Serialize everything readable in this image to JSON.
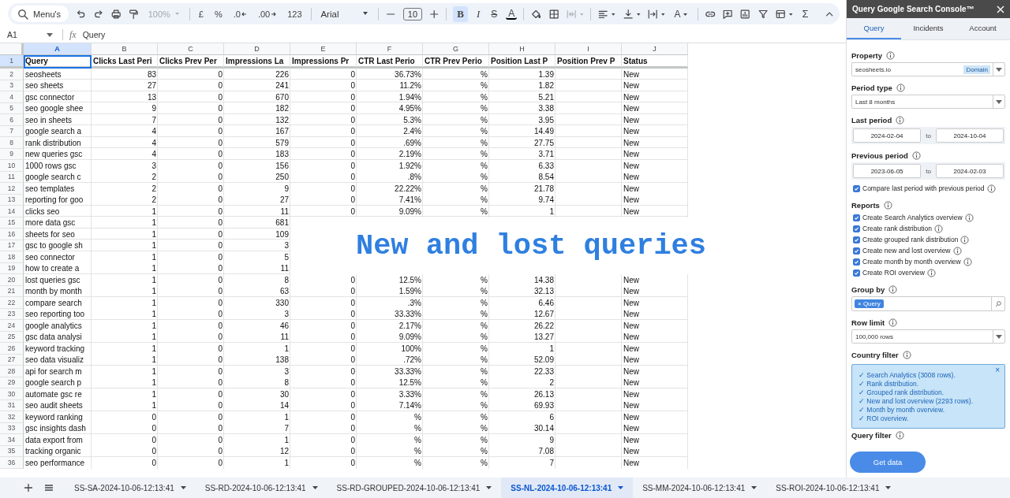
{
  "toolbar": {
    "search": "Menu's",
    "zoom": {
      "label": "100%",
      "disabled": true
    },
    "currency": "£",
    "percent": "%",
    "decrease_decimals": ".0",
    "increase_decimals": ".00",
    "number_format": "123",
    "font": "Arial",
    "font_size": "10",
    "bold": {
      "glyph": "B",
      "selected": true
    },
    "italic": {
      "glyph": "I",
      "selected": false
    },
    "strikethrough": {
      "glyph": "S"
    },
    "text_color": {
      "glyph": "A"
    },
    "merge": {
      "disabled": true
    },
    "text_rotation": {
      "glyph": "A"
    },
    "functions": "Σ"
  },
  "formula_bar": {
    "cell": "A1",
    "fx": "fx",
    "value": "Query"
  },
  "columns": [
    {
      "letter": "A",
      "selected": true
    },
    {
      "letter": "B",
      "selected": false
    },
    {
      "letter": "C",
      "selected": false
    },
    {
      "letter": "D",
      "selected": false
    },
    {
      "letter": "E",
      "selected": false
    },
    {
      "letter": "F",
      "selected": false
    },
    {
      "letter": "G",
      "selected": false
    },
    {
      "letter": "H",
      "selected": false
    },
    {
      "letter": "I",
      "selected": false
    },
    {
      "letter": "J",
      "selected": false
    }
  ],
  "header_row": {
    "number": "1",
    "cells": [
      {
        "text": "Query",
        "selected": true
      },
      {
        "text": "Clicks Last Peri",
        "selected": false
      },
      {
        "text": "Clicks Prev Per",
        "selected": false
      },
      {
        "text": "Impressions La",
        "selected": false
      },
      {
        "text": "Impressions Pr",
        "selected": false
      },
      {
        "text": "CTR Last Perio",
        "selected": false
      },
      {
        "text": "CTR Prev Perio",
        "selected": false
      },
      {
        "text": "Position Last P",
        "selected": false
      },
      {
        "text": "Position Prev P",
        "selected": false
      },
      {
        "text": "Status",
        "selected": false
      }
    ]
  },
  "rows": [
    {
      "number": "2",
      "query": "seosheets",
      "clicks_last": "83",
      "clicks_prev": "0",
      "impr_last": "226",
      "impr_prev": "0",
      "ctr_last": "36.73%",
      "ctr_prev": "%",
      "pos_last": "1.39",
      "status": "New"
    },
    {
      "number": "3",
      "query": "seo sheets",
      "clicks_last": "27",
      "clicks_prev": "0",
      "impr_last": "241",
      "impr_prev": "0",
      "ctr_last": "11.2%",
      "ctr_prev": "%",
      "pos_last": "1.82",
      "status": "New"
    },
    {
      "number": "4",
      "query": "gsc connector",
      "clicks_last": "13",
      "clicks_prev": "0",
      "impr_last": "670",
      "impr_prev": "0",
      "ctr_last": "1.94%",
      "ctr_prev": "%",
      "pos_last": "5.21",
      "status": "New"
    },
    {
      "number": "5",
      "query": "seo google shee",
      "clicks_last": "9",
      "clicks_prev": "0",
      "impr_last": "182",
      "impr_prev": "0",
      "ctr_last": "4.95%",
      "ctr_prev": "%",
      "pos_last": "3.38",
      "status": "New"
    },
    {
      "number": "6",
      "query": "seo in sheets",
      "clicks_last": "7",
      "clicks_prev": "0",
      "impr_last": "132",
      "impr_prev": "0",
      "ctr_last": "5.3%",
      "ctr_prev": "%",
      "pos_last": "3.95",
      "status": "New"
    },
    {
      "number": "7",
      "query": "google search a",
      "clicks_last": "4",
      "clicks_prev": "0",
      "impr_last": "167",
      "impr_prev": "0",
      "ctr_last": "2.4%",
      "ctr_prev": "%",
      "pos_last": "14.49",
      "status": "New"
    },
    {
      "number": "8",
      "query": "rank distribution",
      "clicks_last": "4",
      "clicks_prev": "0",
      "impr_last": "579",
      "impr_prev": "0",
      "ctr_last": ".69%",
      "ctr_prev": "%",
      "pos_last": "27.75",
      "status": "New"
    },
    {
      "number": "9",
      "query": "new queries gsc",
      "clicks_last": "4",
      "clicks_prev": "0",
      "impr_last": "183",
      "impr_prev": "0",
      "ctr_last": "2.19%",
      "ctr_prev": "%",
      "pos_last": "3.71",
      "status": "New"
    },
    {
      "number": "10",
      "query": "1000 rows gsc",
      "clicks_last": "3",
      "clicks_prev": "0",
      "impr_last": "156",
      "impr_prev": "0",
      "ctr_last": "1.92%",
      "ctr_prev": "%",
      "pos_last": "6.33",
      "status": "New"
    },
    {
      "number": "11",
      "query": "google search c",
      "clicks_last": "2",
      "clicks_prev": "0",
      "impr_last": "250",
      "impr_prev": "0",
      "ctr_last": ".8%",
      "ctr_prev": "%",
      "pos_last": "8.54",
      "status": "New"
    },
    {
      "number": "12",
      "query": "seo templates",
      "clicks_last": "2",
      "clicks_prev": "0",
      "impr_last": "9",
      "impr_prev": "0",
      "ctr_last": "22.22%",
      "ctr_prev": "%",
      "pos_last": "21.78",
      "status": "New"
    },
    {
      "number": "13",
      "query": "reporting for goo",
      "clicks_last": "2",
      "clicks_prev": "0",
      "impr_last": "27",
      "impr_prev": "0",
      "ctr_last": "7.41%",
      "ctr_prev": "%",
      "pos_last": "9.74",
      "status": "New"
    },
    {
      "number": "14",
      "query": "clicks seo",
      "clicks_last": "1",
      "clicks_prev": "0",
      "impr_last": "11",
      "impr_prev": "0",
      "ctr_last": "9.09%",
      "ctr_prev": "%",
      "pos_last": "1",
      "status": "New"
    },
    {
      "number": "15",
      "query": "more data gsc",
      "clicks_last": "1",
      "clicks_prev": "0",
      "impr_last": "681"
    },
    {
      "number": "16",
      "query": "sheets for seo",
      "clicks_last": "1",
      "clicks_prev": "0",
      "impr_last": "109"
    },
    {
      "number": "17",
      "query": "gsc to google sh",
      "clicks_last": "1",
      "clicks_prev": "0",
      "impr_last": "3"
    },
    {
      "number": "18",
      "query": "seo connector",
      "clicks_last": "1",
      "clicks_prev": "0",
      "impr_last": "5"
    },
    {
      "number": "19",
      "query": "how to create a",
      "clicks_last": "1",
      "clicks_prev": "0",
      "impr_last": "11"
    },
    {
      "number": "20",
      "query": "lost queries gsc",
      "clicks_last": "1",
      "clicks_prev": "0",
      "impr_last": "8",
      "impr_prev": "0",
      "ctr_last": "12.5%",
      "ctr_prev": "%",
      "pos_last": "14.38",
      "status": "New"
    },
    {
      "number": "21",
      "query": "month by month",
      "clicks_last": "1",
      "clicks_prev": "0",
      "impr_last": "63",
      "impr_prev": "0",
      "ctr_last": "1.59%",
      "ctr_prev": "%",
      "pos_last": "32.13",
      "status": "New"
    },
    {
      "number": "22",
      "query": "compare search",
      "clicks_last": "1",
      "clicks_prev": "0",
      "impr_last": "330",
      "impr_prev": "0",
      "ctr_last": ".3%",
      "ctr_prev": "%",
      "pos_last": "6.46",
      "status": "New"
    },
    {
      "number": "23",
      "query": "seo reporting too",
      "clicks_last": "1",
      "clicks_prev": "0",
      "impr_last": "3",
      "impr_prev": "0",
      "ctr_last": "33.33%",
      "ctr_prev": "%",
      "pos_last": "12.67",
      "status": "New"
    },
    {
      "number": "24",
      "query": "google analytics",
      "clicks_last": "1",
      "clicks_prev": "0",
      "impr_last": "46",
      "impr_prev": "0",
      "ctr_last": "2.17%",
      "ctr_prev": "%",
      "pos_last": "26.22",
      "status": "New"
    },
    {
      "number": "25",
      "query": "gsc data analysi",
      "clicks_last": "1",
      "clicks_prev": "0",
      "impr_last": "11",
      "impr_prev": "0",
      "ctr_last": "9.09%",
      "ctr_prev": "%",
      "pos_last": "13.27",
      "status": "New"
    },
    {
      "number": "26",
      "query": "keyword tracking",
      "clicks_last": "1",
      "clicks_prev": "0",
      "impr_last": "1",
      "impr_prev": "0",
      "ctr_last": "100%",
      "ctr_prev": "%",
      "pos_last": "1",
      "status": "New"
    },
    {
      "number": "27",
      "query": "seo data visualiz",
      "clicks_last": "1",
      "clicks_prev": "0",
      "impr_last": "138",
      "impr_prev": "0",
      "ctr_last": ".72%",
      "ctr_prev": "%",
      "pos_last": "52.09",
      "status": "New"
    },
    {
      "number": "28",
      "query": "api for search m",
      "clicks_last": "1",
      "clicks_prev": "0",
      "impr_last": "3",
      "impr_prev": "0",
      "ctr_last": "33.33%",
      "ctr_prev": "%",
      "pos_last": "22.33",
      "status": "New"
    },
    {
      "number": "29",
      "query": "google search p",
      "clicks_last": "1",
      "clicks_prev": "0",
      "impr_last": "8",
      "impr_prev": "0",
      "ctr_last": "12.5%",
      "ctr_prev": "%",
      "pos_last": "2",
      "status": "New"
    },
    {
      "number": "30",
      "query": "automate gsc re",
      "clicks_last": "1",
      "clicks_prev": "0",
      "impr_last": "30",
      "impr_prev": "0",
      "ctr_last": "3.33%",
      "ctr_prev": "%",
      "pos_last": "26.13",
      "status": "New"
    },
    {
      "number": "31",
      "query": "seo audit sheets",
      "clicks_last": "1",
      "clicks_prev": "0",
      "impr_last": "14",
      "impr_prev": "0",
      "ctr_last": "7.14%",
      "ctr_prev": "%",
      "pos_last": "69.93",
      "status": "New"
    },
    {
      "number": "32",
      "query": "keyword ranking",
      "clicks_last": "0",
      "clicks_prev": "0",
      "impr_last": "1",
      "impr_prev": "0",
      "ctr_last": "%",
      "ctr_prev": "%",
      "pos_last": "6",
      "status": "New"
    },
    {
      "number": "33",
      "query": "gsc insights dash",
      "clicks_last": "0",
      "clicks_prev": "0",
      "impr_last": "7",
      "impr_prev": "0",
      "ctr_last": "%",
      "ctr_prev": "%",
      "pos_last": "30.14",
      "status": "New"
    },
    {
      "number": "34",
      "query": "data export from",
      "clicks_last": "0",
      "clicks_prev": "0",
      "impr_last": "1",
      "impr_prev": "0",
      "ctr_last": "%",
      "ctr_prev": "%",
      "pos_last": "9",
      "status": "New"
    },
    {
      "number": "35",
      "query": "tracking organic",
      "clicks_last": "0",
      "clicks_prev": "0",
      "impr_last": "12",
      "impr_prev": "0",
      "ctr_last": "%",
      "ctr_prev": "%",
      "pos_last": "7.08",
      "status": "New"
    },
    {
      "number": "36",
      "query": "seo performance",
      "clicks_last": "0",
      "clicks_prev": "0",
      "impr_last": "1",
      "impr_prev": "0",
      "ctr_last": "%",
      "ctr_prev": "%",
      "pos_last": "7",
      "status": "New"
    }
  ],
  "overlay_title": "New and lost queries",
  "sidebar": {
    "title": "Query Google Search Console™",
    "tabs": [
      {
        "label": "Query",
        "selected": true
      },
      {
        "label": "Incidents",
        "selected": false
      },
      {
        "label": "Account",
        "selected": false
      }
    ],
    "property": {
      "label": "Property",
      "value": "seosheets.io",
      "tag": "Domain"
    },
    "period_type": {
      "label": "Period type",
      "value": "Last 8 months"
    },
    "last_period": {
      "label": "Last period",
      "from": "2024-02-04",
      "to_word": "to",
      "to": "2024-10-04"
    },
    "previous_period": {
      "label": "Previous period",
      "from": "2023-06-05",
      "to_word": "to",
      "to": "2024-02-03"
    },
    "compare": {
      "label": "Compare last period with previous period",
      "checked": true
    },
    "reports": {
      "label": "Reports",
      "items": [
        {
          "label": "Create Search Analytics overview",
          "checked": true
        },
        {
          "label": "Create rank distribution",
          "checked": true
        },
        {
          "label": "Create grouped rank distribution",
          "checked": true
        },
        {
          "label": "Create new and lost overview",
          "checked": true
        },
        {
          "label": "Create month by month overview",
          "checked": true
        },
        {
          "label": "Create ROI overview",
          "checked": true
        }
      ]
    },
    "group_by": {
      "label": "Group by",
      "chips": [
        {
          "remove": "×",
          "label": "Query"
        }
      ]
    },
    "row_limit": {
      "label": "Row limit",
      "value": "100,000 rows"
    },
    "country_filter": {
      "label": "Country filter"
    },
    "notice": {
      "close": "×",
      "lines": [
        "✓ Search Analytics (3008 rows).",
        "✓ Rank distribution.",
        "✓ Grouped rank distribution.",
        "✓ New and lost overview (2293 rows).",
        "✓ Month by month overview.",
        "✓ ROI overview."
      ]
    },
    "query_filter": {
      "label": "Query filter"
    },
    "button": "Get data"
  },
  "sheet_tabs": [
    {
      "label": "SS-SA-2024-10-06-12:13:41",
      "selected": false
    },
    {
      "label": "SS-RD-2024-10-06-12:13:41",
      "selected": false
    },
    {
      "label": "SS-RD-GROUPED-2024-10-06-12:13:41",
      "selected": false
    },
    {
      "label": "SS-NL-2024-10-06-12:13:41",
      "selected": true
    },
    {
      "label": "SS-MM-2024-10-06-12:13:41",
      "selected": false
    },
    {
      "label": "SS-ROI-2024-10-06-12:13:41",
      "selected": false
    }
  ]
}
